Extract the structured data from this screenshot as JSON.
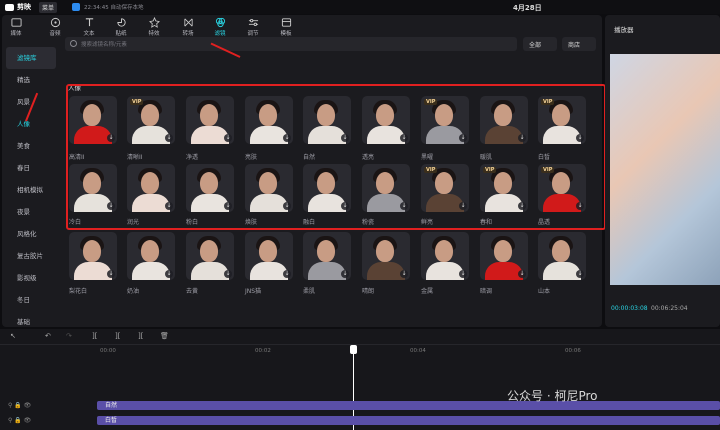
{
  "titlebar": {
    "app_name": "剪映",
    "menu": "菜单",
    "save_status": "22:34:45 自动保存本地",
    "project_title": "4月28日"
  },
  "toolbar": [
    {
      "label": "媒体"
    },
    {
      "label": "音频"
    },
    {
      "label": "文本"
    },
    {
      "label": "贴纸"
    },
    {
      "label": "特效"
    },
    {
      "label": "转场"
    },
    {
      "label": "滤镜"
    },
    {
      "label": "调节"
    },
    {
      "label": "模板"
    }
  ],
  "sidebar": [
    {
      "label": "滤镜库"
    },
    {
      "label": "精选"
    },
    {
      "label": "风景"
    },
    {
      "label": "人像"
    },
    {
      "label": "美食"
    },
    {
      "label": "春日"
    },
    {
      "label": "相机模拟"
    },
    {
      "label": "夜景"
    },
    {
      "label": "风格化"
    },
    {
      "label": "复古胶片"
    },
    {
      "label": "影视级"
    },
    {
      "label": "冬日"
    },
    {
      "label": "基础"
    }
  ],
  "search": {
    "placeholder": "搜索滤镜名称/元素",
    "filter_all": "全部",
    "shop": "商店"
  },
  "section_title": "人像",
  "filters": [
    {
      "name": "高清II",
      "vip": false
    },
    {
      "name": "清晰II",
      "vip": true
    },
    {
      "name": "净透",
      "vip": false
    },
    {
      "name": "亮肤",
      "vip": false
    },
    {
      "name": "自然",
      "vip": false
    },
    {
      "name": "透亮",
      "vip": false
    },
    {
      "name": "黑曜",
      "vip": true
    },
    {
      "name": "暖肌",
      "vip": false
    },
    {
      "name": "白皙",
      "vip": true
    },
    {
      "name": "冷白",
      "vip": false
    },
    {
      "name": "润光",
      "vip": false
    },
    {
      "name": "粉白",
      "vip": false
    },
    {
      "name": "焕肤",
      "vip": false
    },
    {
      "name": "融白",
      "vip": false
    },
    {
      "name": "粉瓷",
      "vip": false
    },
    {
      "name": "鲜亮",
      "vip": true
    },
    {
      "name": "春和",
      "vip": true
    },
    {
      "name": "晶透",
      "vip": true
    },
    {
      "name": "梨花白",
      "vip": false
    },
    {
      "name": "奶油",
      "vip": false
    },
    {
      "name": "去黄",
      "vip": false
    },
    {
      "name": "JNS猫",
      "vip": false
    },
    {
      "name": "柔肌",
      "vip": false
    },
    {
      "name": "晴朗",
      "vip": false
    },
    {
      "name": "金属",
      "vip": false
    },
    {
      "name": "暗调",
      "vip": false
    },
    {
      "name": "山本",
      "vip": false
    }
  ],
  "player": {
    "title": "播放器",
    "current_time": "00:00:03:08",
    "total_time": "00:06:25:04"
  },
  "timeline": {
    "ruler": [
      "00:00",
      "00:02",
      "00:04",
      "00:06"
    ],
    "track1_clip": "自然",
    "track2_clip": "白皙"
  },
  "watermark": "公众号 · 柯尼Pro"
}
